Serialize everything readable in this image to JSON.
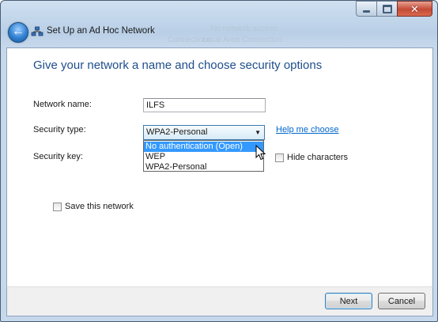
{
  "window": {
    "title": "Set Up an Ad Hoc Network",
    "close_glyph": "✕"
  },
  "background_text": {
    "line1": "No network access",
    "line2": "Connections:",
    "line3": "Local Area Connection"
  },
  "page": {
    "heading": "Give your network a name and choose security options"
  },
  "form": {
    "network_name_label": "Network name:",
    "network_name_value": "ILFS",
    "security_type_label": "Security type:",
    "security_type_value": "WPA2-Personal",
    "security_key_label": "Security key:",
    "help_link": "Help me choose",
    "hide_characters_label": "Hide characters",
    "save_network_label": "Save this network",
    "security_options": [
      "No authentication (Open)",
      "WEP",
      "WPA2-Personal"
    ],
    "highlighted_option": "No authentication (Open)"
  },
  "buttons": {
    "next": "Next",
    "cancel": "Cancel"
  },
  "icons": {
    "back": "back-arrow-icon",
    "network": "network-icon",
    "dropdown": "chevron-down-icon",
    "cursor": "mouse-pointer-icon"
  }
}
